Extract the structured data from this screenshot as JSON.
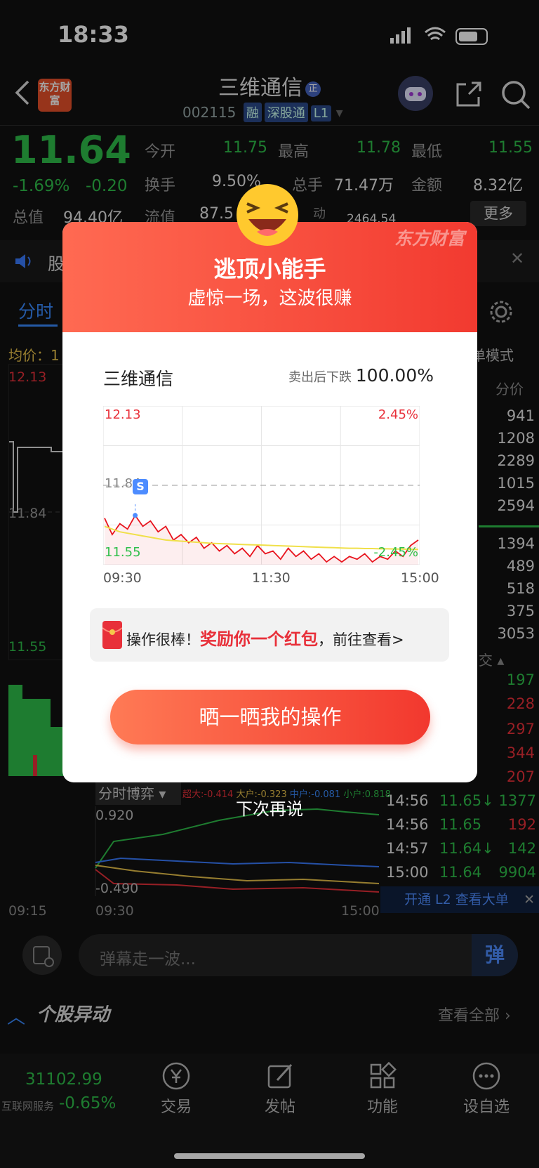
{
  "status": {
    "time": "18:33"
  },
  "header": {
    "logo": "东方财富",
    "title": "三维通信",
    "title_badge": "正",
    "code": "002115",
    "tags": [
      "融",
      "深股通",
      "L1"
    ]
  },
  "quote": {
    "price": "11.64",
    "change_pct": "-1.69%",
    "change": "-0.20",
    "open_label": "今开",
    "open": "11.75",
    "high_label": "最高",
    "high": "11.78",
    "low_label": "最低",
    "low": "11.55",
    "turnover_label": "换手",
    "turnover": "9.50%",
    "vol_label": "总手",
    "vol": "71.47万",
    "amount_label": "金额",
    "amount": "8.32亿",
    "mktcap_label": "总值",
    "mktcap": "94.40亿",
    "float_label": "流值",
    "float": "87.5",
    "extra_label": "动",
    "extra": "2464.54",
    "more": "更多"
  },
  "ticker_text": "股",
  "tabs": {
    "intraday": "分时"
  },
  "avg_label": "均价：1",
  "left_axis": {
    "top": "12.13",
    "mid": "11.84",
    "bottom": "11.55"
  },
  "order_book": {
    "mode": "单模式",
    "header": "分价",
    "asks": [
      "941",
      "1208",
      "2289",
      "1015",
      "2594"
    ],
    "bids": [
      "1394",
      "489",
      "518",
      "375",
      "3053"
    ]
  },
  "trades_header": "交",
  "trade_vols_top": [
    "197",
    "228",
    "297",
    "344",
    "207"
  ],
  "trades": [
    {
      "time": "14:56",
      "price": "11.65↓",
      "vol": "1377"
    },
    {
      "time": "14:56",
      "price": "11.65",
      "vol": "192"
    },
    {
      "time": "14:57",
      "price": "11.64↓",
      "vol": "142"
    },
    {
      "time": "15:00",
      "price": "11.64",
      "vol": "9904"
    }
  ],
  "l2_banner": "开通 L2 查看大单",
  "game": {
    "title": "分时博弈",
    "legend": [
      "超大:-0.414",
      "大户:-0.323",
      "中户:-0.081",
      "小户:0.818"
    ],
    "ytop": "0.920",
    "ybot": "-0.490",
    "times": [
      "09:15",
      "09:30",
      "15:00"
    ]
  },
  "danmu": {
    "placeholder": "弹幕走一波...",
    "button": "弹"
  },
  "section": {
    "title": "个股异动",
    "more": "查看全部"
  },
  "bottom_nav": {
    "index_value": "31102.99",
    "index_name": "互联网服务",
    "index_change": "-0.65%",
    "items": [
      "交易",
      "发帖",
      "功能",
      "设自选"
    ]
  },
  "modal": {
    "brand": "东方财富",
    "title": "逃顶小能手",
    "subtitle": "虚惊一场，这波很赚",
    "stock": "三维通信",
    "metric_label": "卖出后下跌",
    "metric_value": "100.00%",
    "chart_top": "12.13",
    "chart_mid": "11.84",
    "chart_bot": "11.55",
    "pct_top": "2.45%",
    "pct_bot": "-2.45%",
    "marker": "S",
    "x_ticks": [
      "09:30",
      "11:30",
      "15:00"
    ],
    "reward_pre": "操作很棒！",
    "reward_mid": "奖励你一个红包",
    "reward_post": "，前往查看>",
    "share_button": "晒一晒我的操作",
    "dismiss": "下次再说"
  },
  "chart_data": {
    "type": "line",
    "title": "",
    "xlabel": "",
    "ylabel": "",
    "x_ticks": [
      "09:30",
      "11:30",
      "15:00"
    ],
    "ylim": [
      11.55,
      12.13
    ],
    "series": [
      {
        "values": [
          11.72,
          11.66,
          11.7,
          11.68,
          11.73,
          11.69,
          11.71,
          11.67,
          11.69,
          11.64,
          11.66,
          11.63,
          11.65,
          11.61,
          11.63,
          11.6,
          11.62,
          11.59,
          11.61,
          11.58,
          11.62,
          11.59,
          11.6,
          11.57,
          11.61,
          11.58,
          11.6,
          11.57,
          11.59,
          11.56,
          11.58,
          11.56,
          11.58,
          11.57,
          11.59,
          11.56,
          11.58,
          11.57,
          11.6,
          11.58,
          11.62,
          11.64
        ]
      },
      {
        "values": [
          11.69,
          11.68,
          11.67,
          11.665,
          11.66,
          11.655,
          11.65,
          11.645,
          11.64,
          11.638,
          11.636,
          11.634,
          11.632,
          11.63,
          11.628,
          11.627,
          11.626,
          11.625,
          11.624,
          11.623,
          11.622,
          11.621,
          11.62,
          11.619,
          11.618,
          11.617,
          11.616,
          11.615,
          11.614,
          11.613,
          11.612,
          11.611,
          11.61,
          11.61,
          11.609,
          11.609,
          11.608,
          11.608,
          11.607,
          11.607,
          11.606,
          11.606
        ]
      }
    ]
  }
}
